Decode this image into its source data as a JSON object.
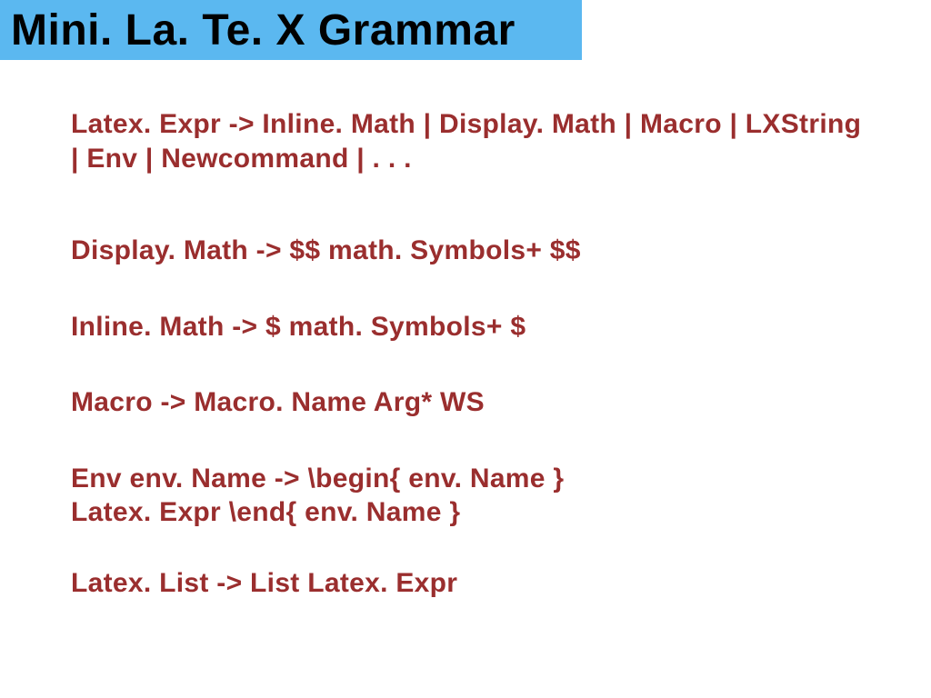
{
  "title": "Mini. La. Te. X Grammar",
  "rules": [
    "Latex. Expr ->  Inline. Math | Display. Math | Macro | LXString | Env | Newcommand | . . .",
    "Display. Math -> $$ math. Symbols+ $$",
    "Inline. Math -> $ math. Symbols+ $",
    "Macro -> Macro. Name Arg* WS",
    "Env env. Name -> \\begin{ env. Name }\n Latex. Expr \\end{ env. Name }",
    "Latex. List -> List Latex. Expr"
  ]
}
